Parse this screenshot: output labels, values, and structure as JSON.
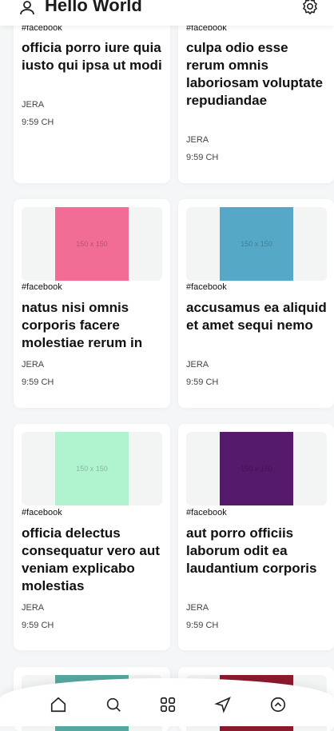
{
  "header": {
    "title": "Hello World",
    "left_icon": "users-icon",
    "right_icon": "gear-icon"
  },
  "placeholder_label": "150 x 150",
  "posts": [
    {
      "tag": "#facebook",
      "title": "officia porro iure quia iusto qui ipsa ut modi",
      "author": "JERA",
      "time": "9:59 CH",
      "color": ""
    },
    {
      "tag": "#facebook",
      "title": "culpa odio esse rerum omnis laboriosam voluptate repudiandae",
      "author": "JERA",
      "time": "9:59 CH",
      "color": ""
    },
    {
      "tag": "#facebook",
      "title": "natus nisi omnis corporis facere molestiae rerum in",
      "author": "JERA",
      "time": "9:59 CH",
      "color": "#f16d95"
    },
    {
      "tag": "#facebook",
      "title": "accusamus ea aliquid et amet sequi nemo",
      "author": "JERA",
      "time": "9:59 CH",
      "color": "#56a8c7"
    },
    {
      "tag": "#facebook",
      "title": "officia delectus consequatur vero aut veniam explicabo molestias",
      "author": "JERA",
      "time": "9:59 CH",
      "color": "#b0f3cf"
    },
    {
      "tag": "#facebook",
      "title": "aut porro officiis laborum odit ea laudantium corporis",
      "author": "JERA",
      "time": "9:59 CH",
      "color": "#551a6b"
    }
  ],
  "next_row_colors": [
    "#56a8a0",
    "#8b1a2e"
  ],
  "bottom_nav": [
    "home-icon",
    "search-icon",
    "grid-icon",
    "send-icon",
    "profile-icon"
  ]
}
